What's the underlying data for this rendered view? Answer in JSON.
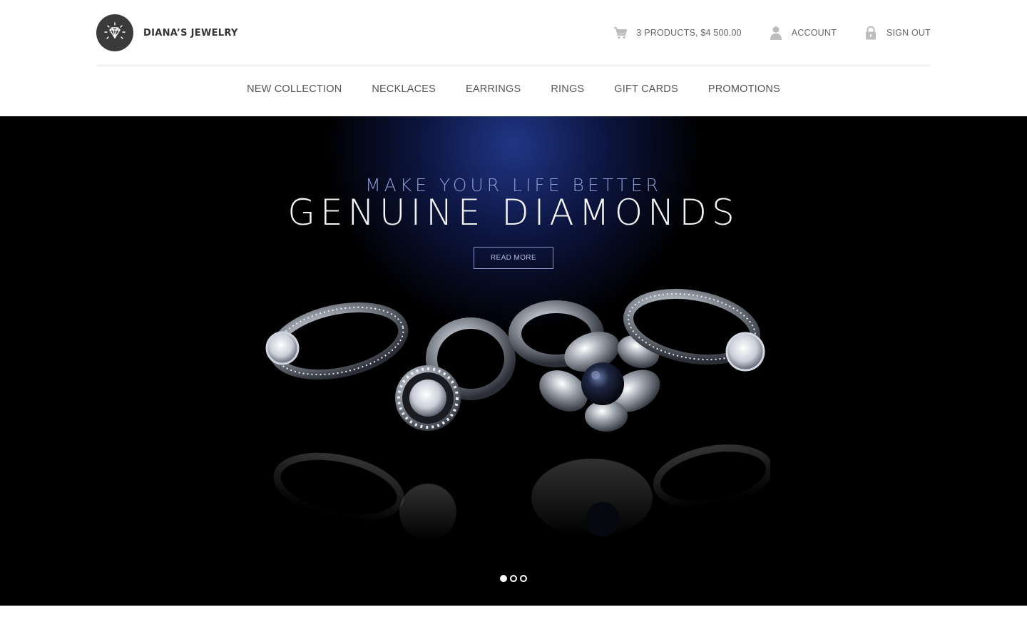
{
  "brand": {
    "name": "DIANA’S JEWELRY",
    "icon": "diamond-icon"
  },
  "user_bar": {
    "cart": {
      "label": "3 PRODUCTS, $4 500.00",
      "icon": "cart-icon"
    },
    "account": {
      "label": "ACCOUNT",
      "icon": "user-icon"
    },
    "sign_out": {
      "label": "SIGN OUT",
      "icon": "lock-icon"
    }
  },
  "nav": {
    "items": [
      {
        "label": "NEW COLLECTION"
      },
      {
        "label": "NECKLACES"
      },
      {
        "label": "EARRINGS"
      },
      {
        "label": "RINGS"
      },
      {
        "label": "GIFT CARDS"
      },
      {
        "label": "PROMOTIONS"
      }
    ]
  },
  "hero": {
    "subtitle": "MAKE YOUR LIFE BETTER",
    "title": "GENUINE DIAMONDS",
    "button": "READ MORE",
    "slides_total": 3,
    "active_slide": 1,
    "image": "diamond-rings-photo"
  },
  "colors": {
    "hero_background": "#000000",
    "hero_glow": "#22388c",
    "subtitle": "#8c9ad3",
    "text_dark": "#333333"
  }
}
